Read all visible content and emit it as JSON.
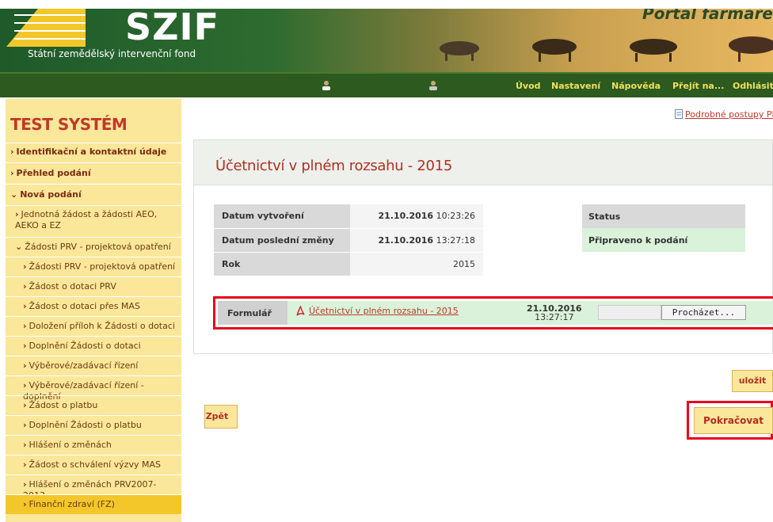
{
  "header": {
    "logo": "SZIF",
    "subtitle": "Státní zemědělský intervenční fond",
    "portal_title": "Portál farmáře"
  },
  "nav": {
    "links": [
      "Úvod",
      "Nastavení",
      "Nápověda",
      "Přejít na...",
      "Odhlásit"
    ]
  },
  "sidebar": {
    "title": "TEST SYSTÉM",
    "items": [
      {
        "label": "Identifikační a kontaktní údaje"
      },
      {
        "label": "Přehled podání"
      },
      {
        "label": "Nová podání"
      },
      {
        "label": "Jednotná žádost a žádosti AEO, AEKO a EZ"
      },
      {
        "label": "Žádosti PRV - projektová opatření"
      },
      {
        "label": "Žádosti PRV - projektová opatření"
      },
      {
        "label": "Žádost o dotaci PRV"
      },
      {
        "label": "Žádost o dotaci přes MAS"
      },
      {
        "label": "Doložení příloh k Žádosti o dotaci"
      },
      {
        "label": "Doplnění Žádosti o dotaci"
      },
      {
        "label": "Výběrové/zadávací řízení"
      },
      {
        "label": "Výběrové/zadávací řízení - doplnění"
      },
      {
        "label": "Žádost o platbu"
      },
      {
        "label": "Doplnění Žádosti o platbu"
      },
      {
        "label": "Hlášení o změnách"
      },
      {
        "label": "Žádost o schválení výzvy MAS"
      },
      {
        "label": "Hlášení o změnách PRV2007-2013"
      },
      {
        "label": "Finanční zdraví (FZ)"
      }
    ]
  },
  "help_link": "Podrobné postupy PRV",
  "panel": {
    "title": "Účetnictví v plném rozsahu - 2015",
    "rows": [
      {
        "label": "Datum vytvoření",
        "date": "21.10.2016",
        "time": "10:23:26"
      },
      {
        "label": "Datum poslední změny",
        "date": "21.10.2016",
        "time": "13:27:18"
      },
      {
        "label": "Rok",
        "date": "",
        "time": "2015"
      }
    ],
    "status_label": "Status",
    "status_value": "Připraveno k podání",
    "form": {
      "label": "Formulář",
      "file_name": "Účetnictví v plném rozsahu - 2015",
      "date": "21.10.2016",
      "time": "13:27:17",
      "browse_label": "Procházet..."
    }
  },
  "buttons": {
    "save": "uložit",
    "back": "Zpět",
    "continue": "Pokračovat"
  },
  "colors": {
    "nav_bg": "#2d5a1e",
    "nav_link": "#f0e060",
    "sidebar_bg": "#fbe79a",
    "accent_red": "#c0392b",
    "highlight_frame": "#e8001c"
  }
}
